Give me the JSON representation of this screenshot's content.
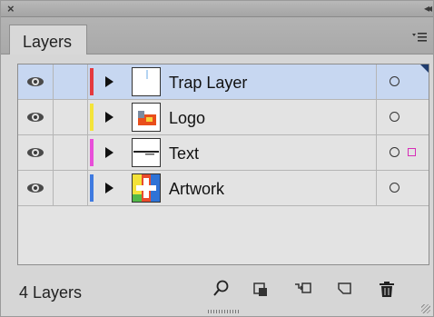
{
  "panel": {
    "tab_label": "Layers",
    "layer_count": "4 Layers"
  },
  "layers": [
    {
      "name": "Trap Layer",
      "color": "#e4393f",
      "visible": true,
      "selected": true
    },
    {
      "name": "Logo",
      "color": "#f4e43a",
      "visible": true,
      "selected": false
    },
    {
      "name": "Text",
      "color": "#e84ed9",
      "visible": true,
      "selected": false,
      "has_selection": true
    },
    {
      "name": "Artwork",
      "color": "#3f7ae0",
      "visible": true,
      "selected": false
    }
  ],
  "icons": {
    "close": "close-icon",
    "collapse": "double-chevron-icon",
    "menu": "panel-menu-icon",
    "eye": "eye-icon",
    "expand": "expand-triangle-icon",
    "target": "target-circle-icon",
    "locate": "search-icon",
    "clip": "clipping-mask-icon",
    "sublayer": "new-sublayer-icon",
    "newlayer": "new-layer-icon",
    "delete": "trash-icon"
  },
  "colors": {
    "selected_row": "#c7d7f1",
    "selection_square": "#d62db7"
  }
}
